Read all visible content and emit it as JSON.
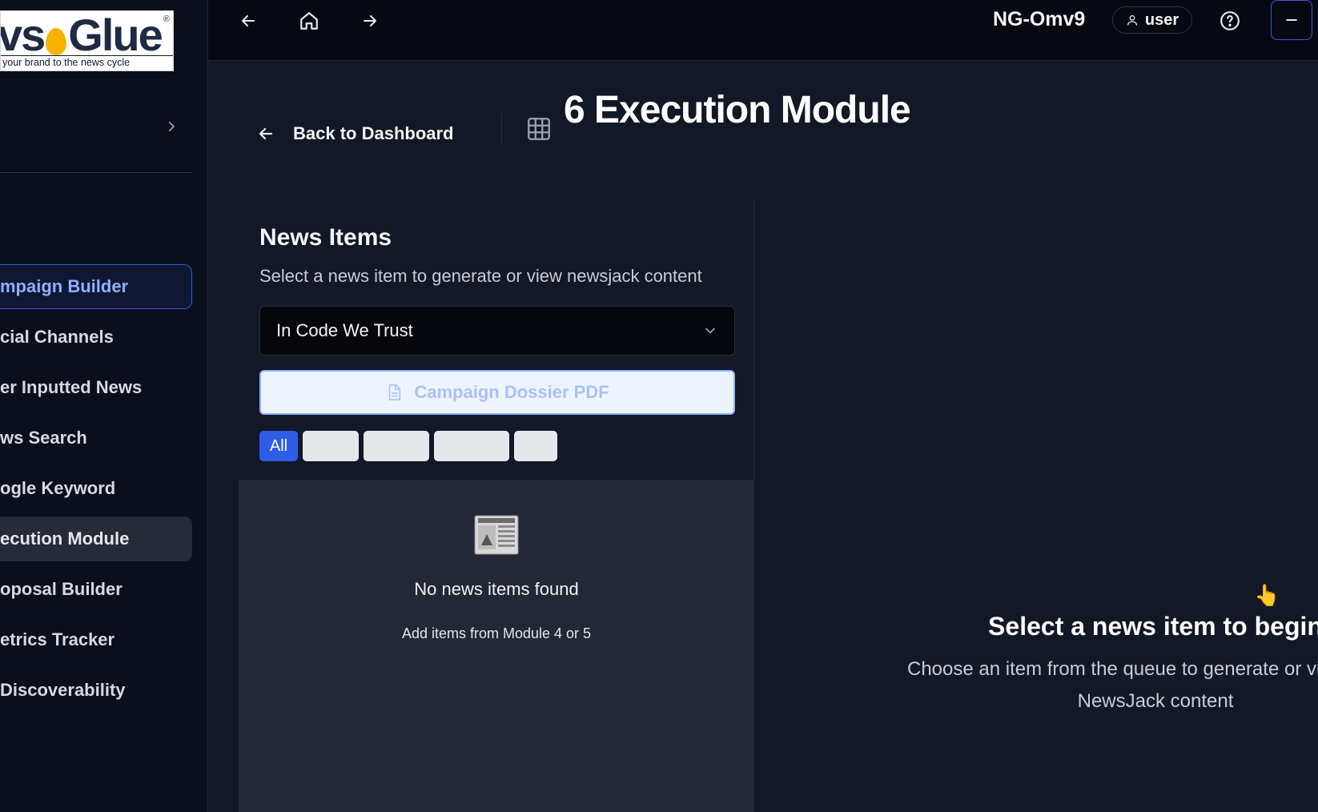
{
  "logo": {
    "word_left": "vs",
    "word_right": "Glue",
    "registered": "®",
    "tagline": "your brand to the news cycle"
  },
  "sidebar": {
    "items": [
      {
        "label": "mpaign Builder",
        "state": "active"
      },
      {
        "label": "cial Channels"
      },
      {
        "label": "er Inputted News"
      },
      {
        "label": "ws Search"
      },
      {
        "label": "ogle Keyword"
      },
      {
        "label": "ecution Module",
        "state": "current"
      },
      {
        "label": "oposal Builder"
      },
      {
        "label": "etrics Tracker"
      },
      {
        "label": "Discoverability"
      }
    ]
  },
  "topbar": {
    "title": "NG-Omv9",
    "user_label": "user"
  },
  "header": {
    "back_label": "Back to Dashboard",
    "page_title": "6 Execution Module"
  },
  "news_panel": {
    "title": "News Items",
    "subtitle": "Select a news item to generate or view newsjack content",
    "select_value": "In Code We Trust",
    "dossier_label": "Campaign Dossier PDF",
    "filter_all": "All",
    "empty_title": "No news items found",
    "empty_sub": "Add items from Module 4 or 5"
  },
  "right_panel": {
    "pointer_emoji": "👆",
    "title": "Select a news item to begin",
    "subtitle_line1": "Choose an item from the queue to generate or vi",
    "subtitle_line2": "NewsJack content"
  },
  "colors": {
    "accent": "#2f5ce6",
    "active_border": "#3b5bdb",
    "bg": "#0b0f1c",
    "panel": "#222836"
  }
}
